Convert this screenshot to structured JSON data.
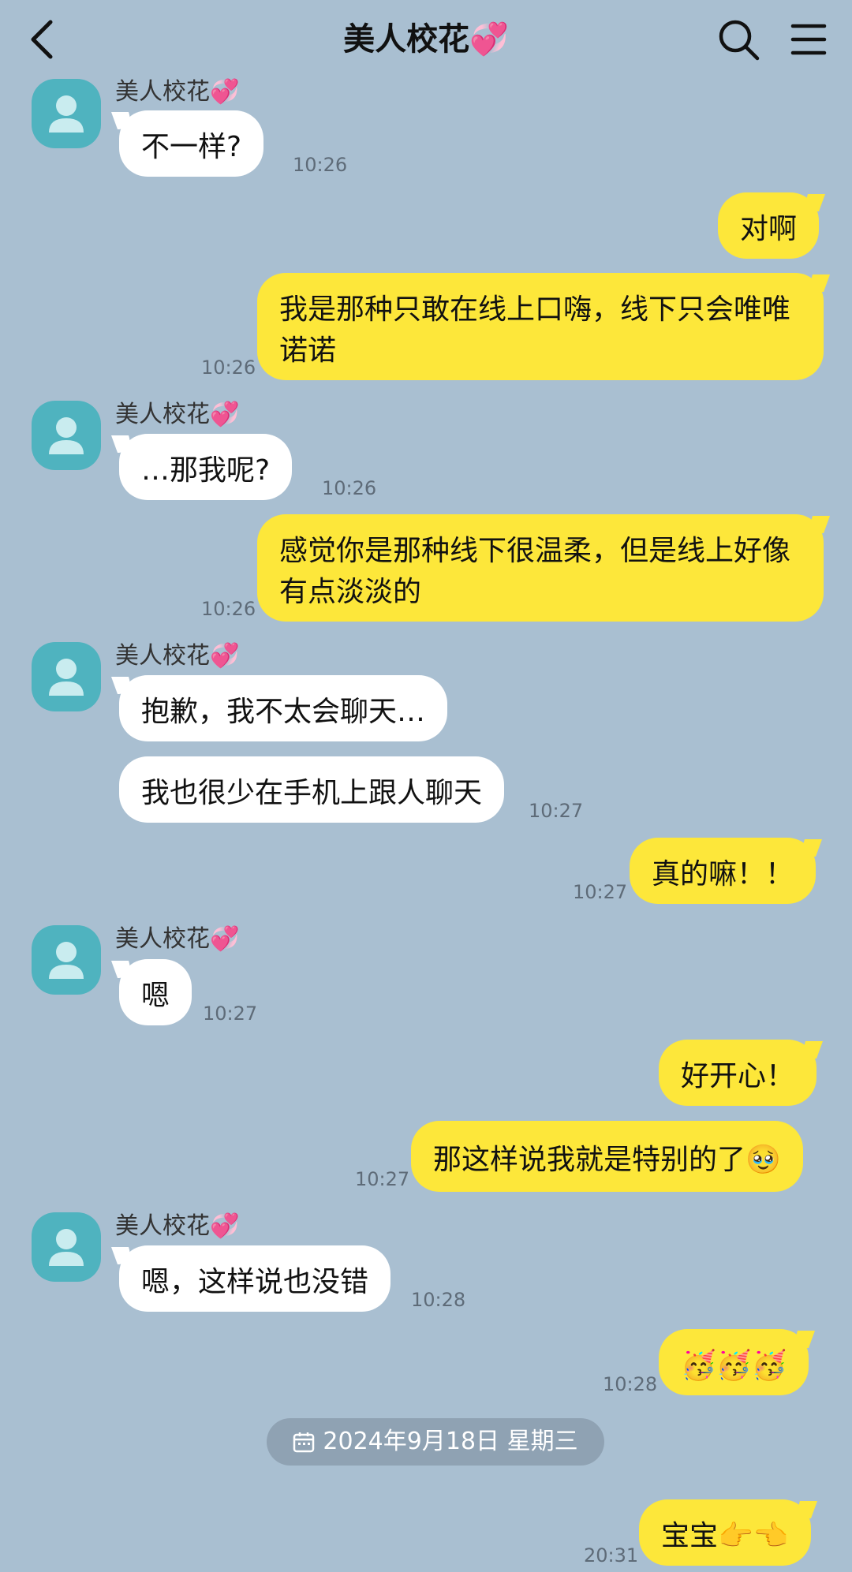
{
  "header": {
    "title": "美人校花💞",
    "back_icon": "chevron-left-icon",
    "search_icon": "search-icon",
    "menu_icon": "menu-icon"
  },
  "colors": {
    "background": "#a9bfd1",
    "incoming_bubble": "#ffffff",
    "outgoing_bubble": "#fde73a",
    "avatar": "#4fb3bf",
    "date_pill": "#8fa2b3"
  },
  "contact_name": "美人校花💞",
  "messages": [
    {
      "from": "them",
      "text": "不一样?",
      "time": "10:26"
    },
    {
      "from": "me",
      "text": "对啊",
      "time": ""
    },
    {
      "from": "me",
      "text": "我是那种只敢在线上口嗨，线下只会唯唯诺诺",
      "time": "10:26"
    },
    {
      "from": "them",
      "text": "…那我呢?",
      "time": "10:26"
    },
    {
      "from": "me",
      "text": "感觉你是那种线下很温柔，但是线上好像有点淡淡的",
      "time": "10:26"
    },
    {
      "from": "them",
      "text": "抱歉，我不太会聊天…",
      "time": ""
    },
    {
      "from": "them",
      "text": "我也很少在手机上跟人聊天",
      "time": "10:27"
    },
    {
      "from": "me",
      "text": "真的嘛！！",
      "time": "10:27"
    },
    {
      "from": "them",
      "text": "嗯",
      "time": "10:27"
    },
    {
      "from": "me",
      "text": "好开心！",
      "time": ""
    },
    {
      "from": "me",
      "text": "那这样说我就是特别的了🥹",
      "time": "10:27"
    },
    {
      "from": "them",
      "text": "嗯，这样说也没错",
      "time": "10:28"
    },
    {
      "from": "me",
      "text": "🥳🥳🥳",
      "time": "10:28"
    },
    {
      "from": "me",
      "text": "宝宝👉👈",
      "time": "20:31"
    }
  ],
  "date_separator": {
    "icon": "calendar-icon",
    "text": "2024年9月18日 星期三"
  }
}
